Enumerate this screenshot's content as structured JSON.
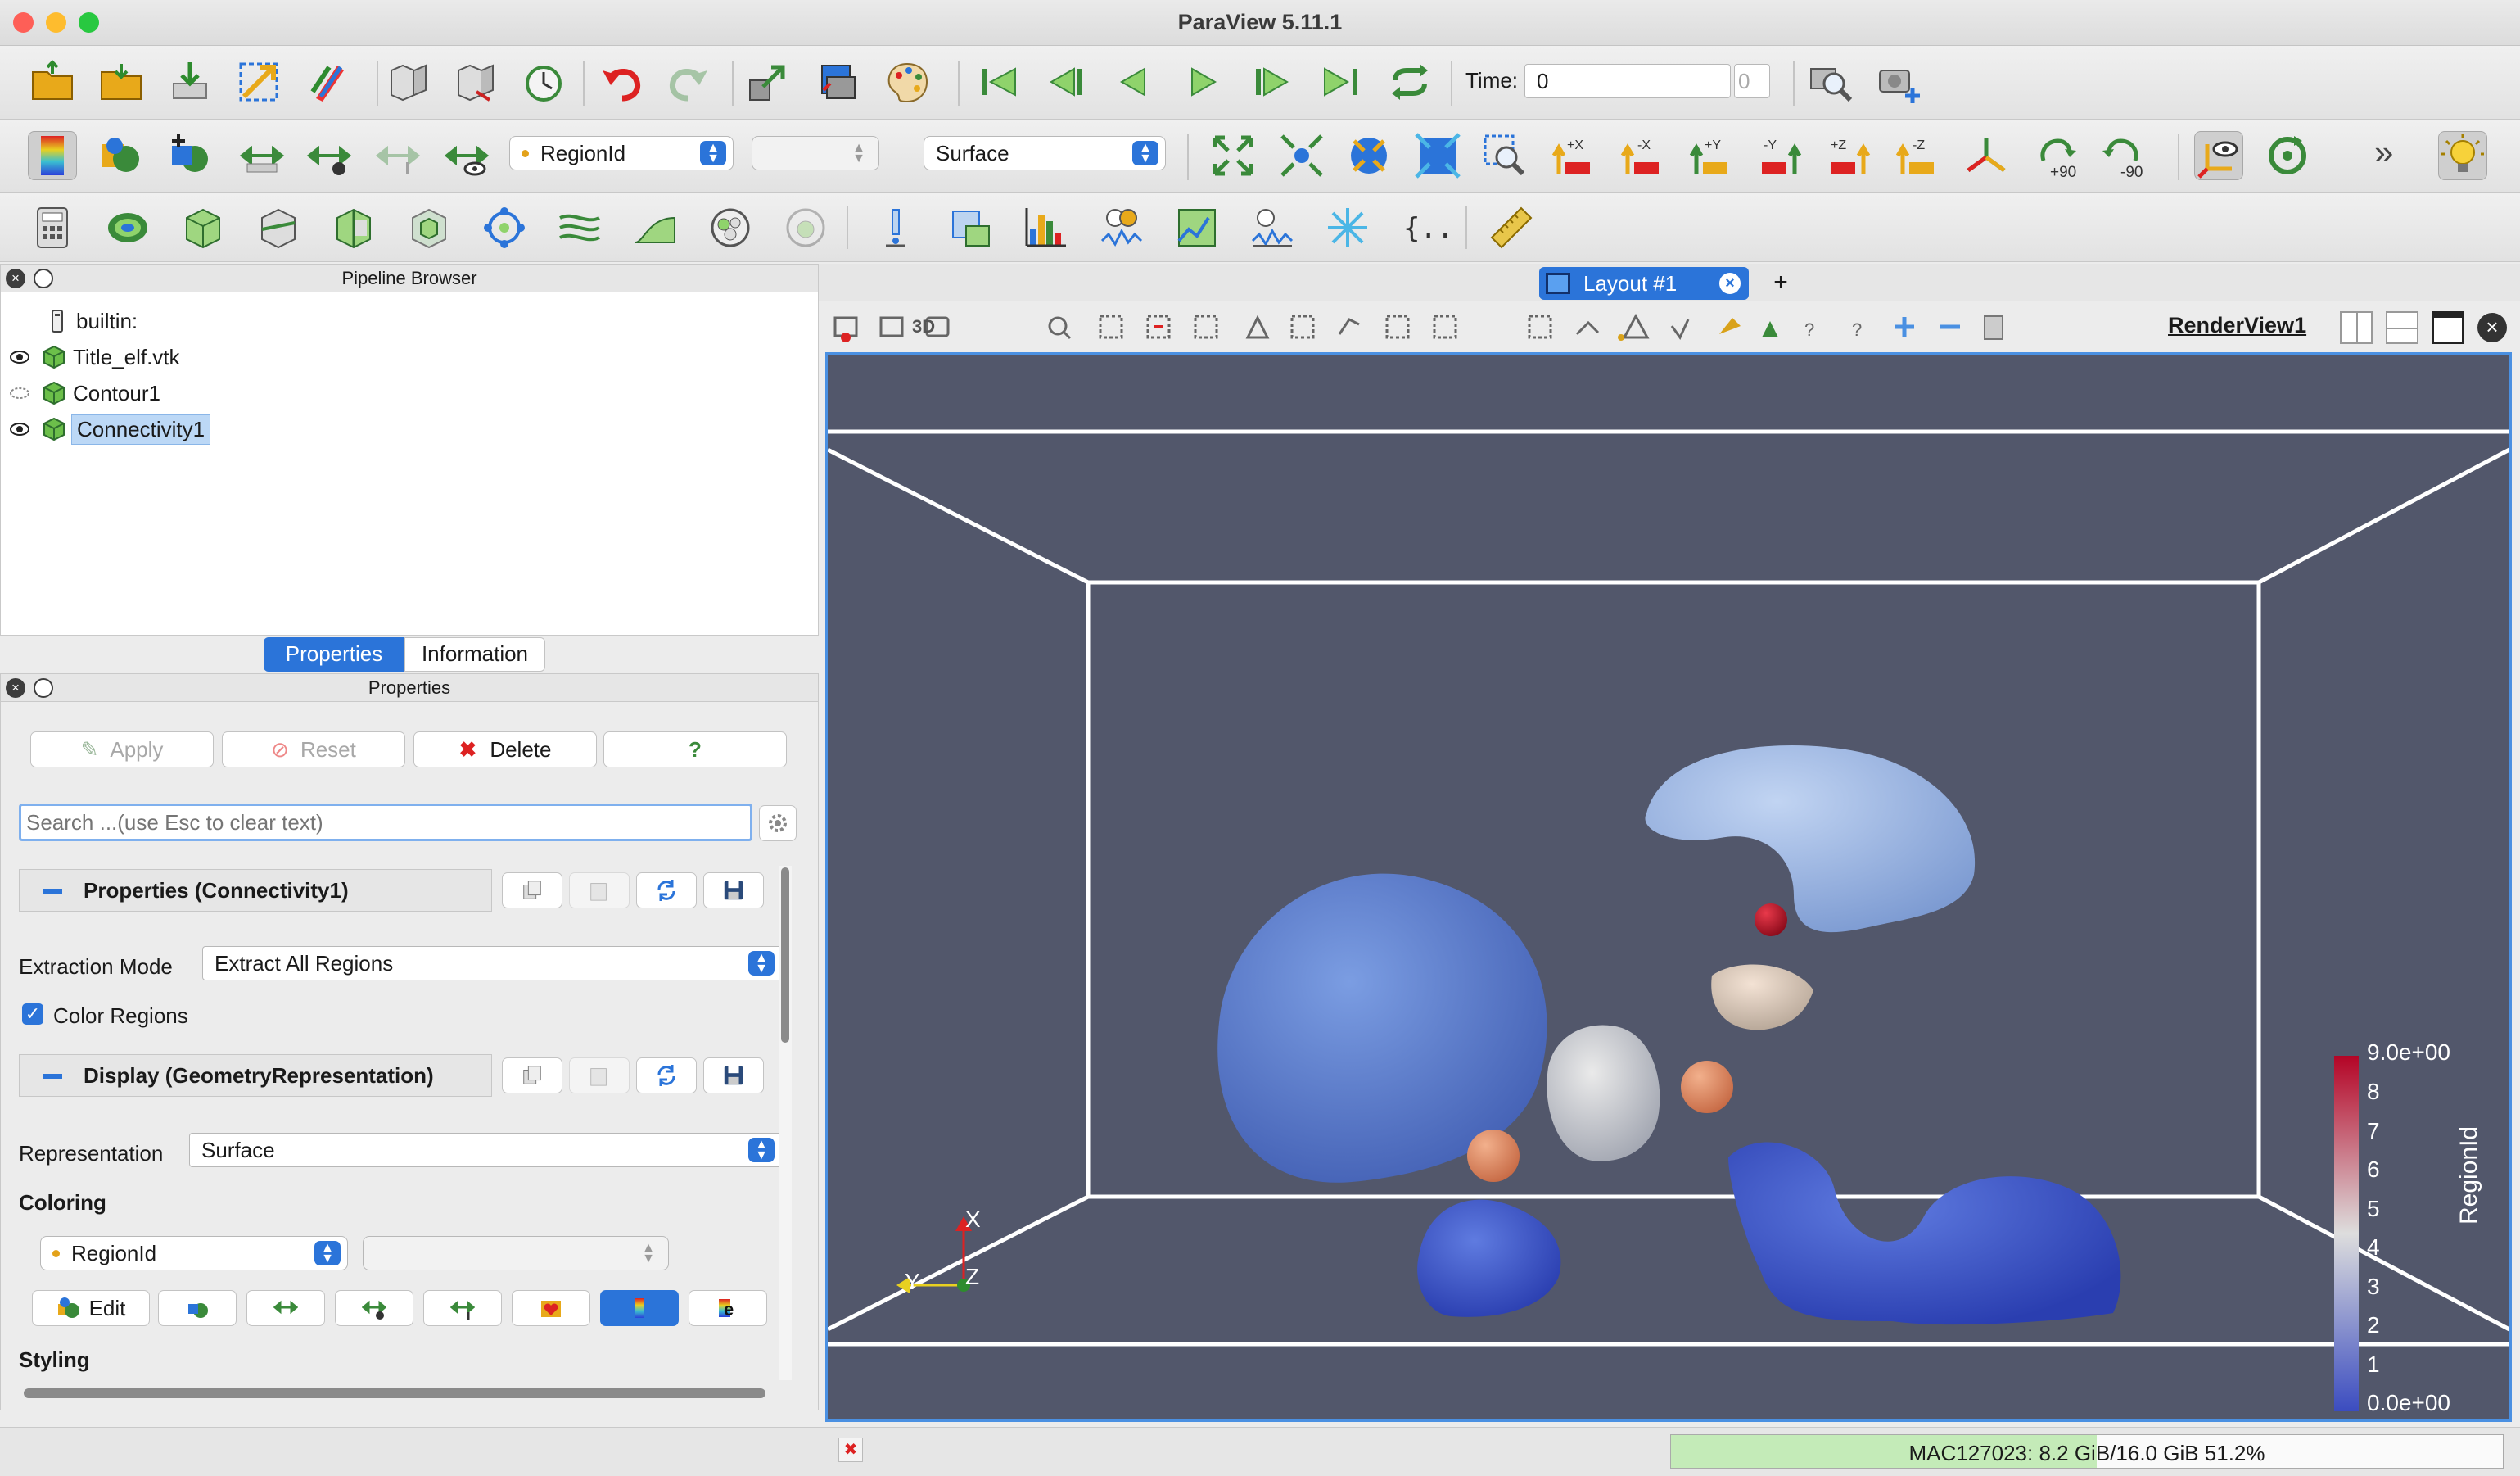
{
  "window": {
    "title": "ParaView 5.11.1"
  },
  "toolbar_main": {
    "time_label": "Time:",
    "time_value": "0",
    "time_index": "0"
  },
  "toolbar_color": {
    "color_array": "RegionId",
    "component": "",
    "representation": "Surface",
    "rot_pos_label": "+90",
    "rot_neg_label": "-90",
    "axis_labels": [
      "+X",
      "-X",
      "+Y",
      "-Y",
      "+Z",
      "-Z"
    ]
  },
  "pipeline": {
    "title": "Pipeline Browser",
    "items": [
      {
        "label": "builtin:"
      },
      {
        "label": "Title_elf.vtk"
      },
      {
        "label": "Contour1"
      },
      {
        "label": "Connectivity1"
      }
    ]
  },
  "tabs": {
    "properties": "Properties",
    "information": "Information"
  },
  "properties": {
    "title": "Properties",
    "apply": "Apply",
    "reset": "Reset",
    "delete": "Delete",
    "help": "?",
    "search_placeholder": "Search ...(use Esc to clear text)",
    "section_properties": "Properties (Connectivity1)",
    "extraction_mode_label": "Extraction Mode",
    "extraction_mode_value": "Extract All Regions",
    "color_regions_label": "Color Regions",
    "color_regions_checked": true,
    "section_display": "Display (GeometryRepresentation)",
    "representation_label": "Representation",
    "representation_value": "Surface",
    "coloring_label": "Coloring",
    "coloring_array": "RegionId",
    "coloring_component": "",
    "edit_label": "Edit",
    "styling_label": "Styling"
  },
  "layout": {
    "tab_label": "Layout #1",
    "add_tab": "+",
    "view_name": "RenderView1",
    "view_3d_label": "3D"
  },
  "legend": {
    "title": "RegionId",
    "max_label": "9.0e+00",
    "min_label": "0.0e+00",
    "ticks": [
      "8",
      "7",
      "6",
      "5",
      "4",
      "3",
      "2",
      "1"
    ],
    "colors": {
      "high": "#b40426",
      "mid": "#dddddd",
      "low": "#3b4cc0"
    }
  },
  "axes": {
    "x": "X",
    "y": "Y",
    "z": "Z"
  },
  "status": {
    "memory": "MAC127023: 8.2 GiB/16.0 GiB 51.2%",
    "memory_fraction": 0.512
  },
  "colors": {
    "accent": "#2b74d9",
    "render_bg": "#52576b"
  }
}
